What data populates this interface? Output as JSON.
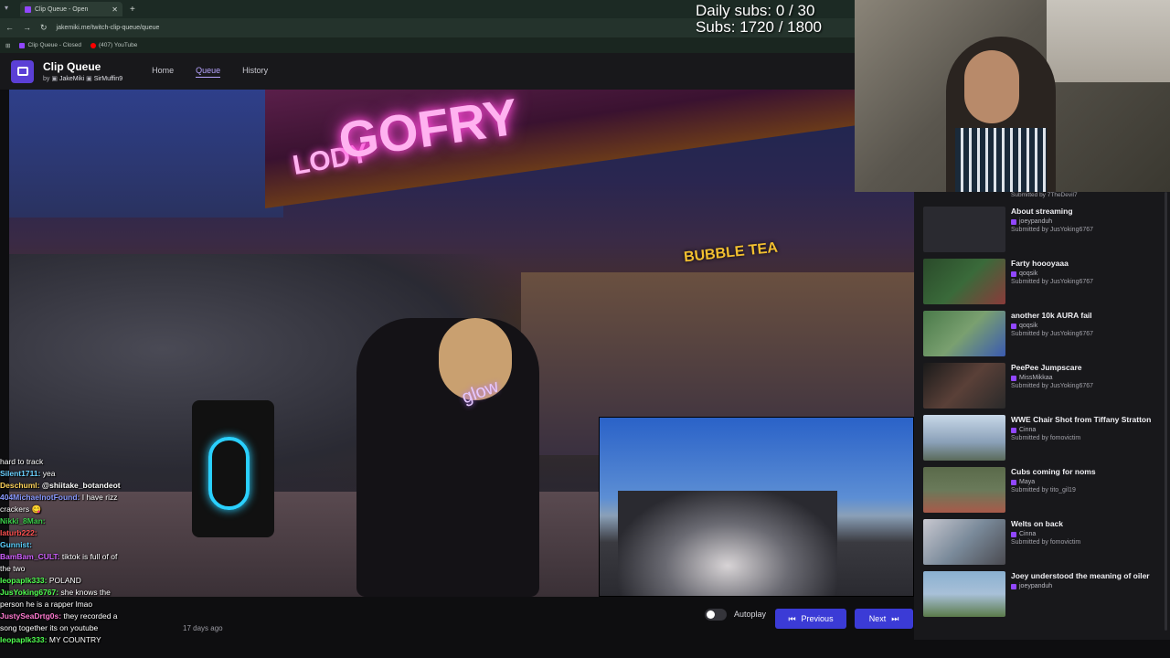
{
  "browser": {
    "tab_title": "Clip Queue - Open",
    "url": "jakemiki.me/twitch-clip-queue/queue",
    "bookmarks": [
      {
        "label": "Clip Queue - Closed",
        "color": "#9147ff"
      },
      {
        "label": "(407) YouTube",
        "color": "#ff0000"
      }
    ]
  },
  "app": {
    "title": "Clip Queue",
    "by": "by",
    "author1": "JakeMiki",
    "author2": "SirMuffin9",
    "nav": [
      "Home",
      "Queue",
      "History"
    ],
    "active_nav": "Queue"
  },
  "overlay": {
    "daily_subs": "Daily subs: 0 / 30",
    "subs": "Subs: 1720 / 1800"
  },
  "video": {
    "sign_main": "GOFRY",
    "sign_left": "LODY",
    "sign_bubble": "BUBBLE TEA",
    "hoodie_text": "glow"
  },
  "queue": {
    "top_partial": "Submitted by 7TheDevil7",
    "submitted_prefix": "Submitted by",
    "items": [
      {
        "title": "About streaming",
        "channel": "joeypanduh",
        "submitter": "JusYoking6767",
        "thumb": "#2a2a30"
      },
      {
        "title": "Farty hoooyaaa",
        "channel": "qoqsik",
        "submitter": "JusYoking6767",
        "thumb": "#3a6a3a"
      },
      {
        "title": "another 10k AURA fail",
        "channel": "qoqsik",
        "submitter": "JusYoking6767",
        "thumb": "#5a8a6a"
      },
      {
        "title": "PeePee Jumpscare",
        "channel": "MissMikkaa",
        "submitter": "JusYoking6767",
        "thumb": "#5a4038"
      },
      {
        "title": "WWE Chair Shot from Tiffany Stratton",
        "channel": "Cinna",
        "submitter": "fomovictim",
        "thumb": "#8aa0b8"
      },
      {
        "title": "Cubs coming for noms",
        "channel": "Maya",
        "submitter": "tito_gil19",
        "thumb": "#6a7a5a"
      },
      {
        "title": "Welts on back",
        "channel": "Cinna",
        "submitter": "fomovictim",
        "thumb": "#7a8a9a"
      },
      {
        "title": "Joey understood the meaning of oiler",
        "channel": "joeypanduh",
        "submitter": "",
        "thumb": "#8ab0d0"
      }
    ]
  },
  "controls": {
    "autoplay": "Autoplay",
    "previous": "Previous",
    "next": "Next"
  },
  "chat": [
    {
      "user": "",
      "color": "#ffffff",
      "msg": "hard to track"
    },
    {
      "user": "Silent1711:",
      "color": "#6ad0ff",
      "msg": "yea"
    },
    {
      "user": "Deschuml:",
      "color": "#ffd35a",
      "msg": "@shiitake_botandeot"
    },
    {
      "user": "404MichaelnotFound:",
      "color": "#8a9aff",
      "msg": "I have rizz"
    },
    {
      "user": "",
      "color": "#ffffff",
      "msg": "crackers 😋"
    },
    {
      "user": "Nikki_8Man:",
      "color": "#3ad04a",
      "msg": ""
    },
    {
      "user": "laturb222:",
      "color": "#ff5050",
      "msg": ""
    },
    {
      "user": "Gunnist:",
      "color": "#5ad0ff",
      "msg": ""
    },
    {
      "user": "BamBam_CULT:",
      "color": "#d060ff",
      "msg": "tiktok is full of of"
    },
    {
      "user": "",
      "color": "#ffffff",
      "msg": "the two"
    },
    {
      "user": "leopaplk333:",
      "color": "#50ff50",
      "msg": "POLAND"
    },
    {
      "user": "JusYoking6767:",
      "color": "#50ff50",
      "msg": "she knows the"
    },
    {
      "user": "",
      "color": "#ffffff",
      "msg": "person he is a rapper lmao"
    },
    {
      "user": "JustySeaDrtg0s:",
      "color": "#ff7ad0",
      "msg": "they recorded a"
    },
    {
      "user": "",
      "color": "#ffffff",
      "msg": "song together its on youtube"
    },
    {
      "user": "leopaplk333:",
      "color": "#50ff50",
      "msg": "MY COUNTRY"
    }
  ],
  "timestamp": "17 days ago"
}
